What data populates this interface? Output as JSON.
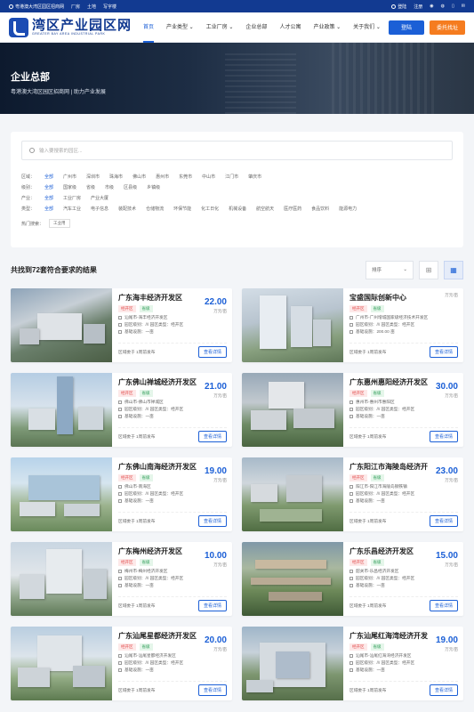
{
  "topbar": {
    "site": "粤港澳大湾区园区招商网",
    "links": [
      "厂房",
      "土地",
      "写字楼"
    ],
    "right": [
      "登陆",
      "注册"
    ]
  },
  "header": {
    "logo_title": "湾区产业园区网",
    "logo_sub": "GREATER BAY AREA INDUSTRIAL PARK",
    "nav": [
      "首页",
      "产业类型 ⌄",
      "工业厂房 ⌄",
      "企业总部",
      "人才公寓",
      "产业政策 ⌄",
      "关于我们 ⌄"
    ],
    "login": "登陆",
    "entrust": "委托找址"
  },
  "banner": {
    "title": "企业总部",
    "subtitle": "粤港澳大湾区园区招商网 | 助力产业发展"
  },
  "filter": {
    "search_placeholder": "输入要搜索的园区...",
    "rows": [
      {
        "label": "区域：",
        "options": [
          "全部",
          "广州市",
          "深圳市",
          "珠海市",
          "佛山市",
          "惠州市",
          "东莞市",
          "中山市",
          "江门市",
          "肇庆市"
        ]
      },
      {
        "label": "级别：",
        "options": [
          "全部",
          "国家级",
          "省级",
          "市级",
          "区县级",
          "乡镇级"
        ]
      },
      {
        "label": "产业：",
        "options": [
          "全部",
          "工业厂房",
          "产业大厦"
        ]
      },
      {
        "label": "类型：",
        "options": [
          "全部",
          "汽车工业",
          "电子信息",
          "装配技术",
          "仓储物流",
          "环保节能",
          "化工日化",
          "机械设备",
          "航空航天",
          "医疗医药",
          "食品饮料",
          "能源电力"
        ]
      }
    ],
    "hot_label": "热门搜索：",
    "hot_tags": [
      "工业用"
    ]
  },
  "results": {
    "title": "共找到72套符合要求的结果",
    "sort": "排序"
  },
  "cards": [
    {
      "name": "广东海丰经济开发区",
      "price": "22.00",
      "unit": "万元/亩",
      "tag1": "经开区",
      "tag2": "省级",
      "loc": "汕尾市-海丰经济开发区",
      "level": "园区级别：/// 园区类型：经开区",
      "facility": "基础设施：一亩",
      "time": "区域委于 1周前发布",
      "btn": "查看详情",
      "img": "a"
    },
    {
      "name": "宝盛国际创新中心",
      "price": "",
      "unit": "万元/亩",
      "tag1": "经开区",
      "tag2": "省级",
      "loc": "广州市-广州增城国家级经济技术开发区",
      "level": "园区级别：/// 园区类型：经开区",
      "facility": "基础设施：200.00 亩",
      "time": "区域委于 1周前发布",
      "btn": "查看详情",
      "img": "b"
    },
    {
      "name": "广东佛山禅城经济开发区",
      "price": "21.00",
      "unit": "万元/亩",
      "tag1": "经开区",
      "tag2": "省级",
      "loc": "佛山市-佛山市禅城区",
      "level": "园区级别：/// 园区类型：经开区",
      "facility": "基础设施：一亩",
      "time": "区域委于 1周前发布",
      "btn": "查看详情",
      "img": "c"
    },
    {
      "name": "广东惠州惠阳经济开发区",
      "price": "30.00",
      "unit": "万元/亩",
      "tag1": "经开区",
      "tag2": "省级",
      "loc": "惠州市-惠州市惠阳区",
      "level": "园区级别：/// 园区类型：经开区",
      "facility": "基础设施：一亩",
      "time": "区域委于 1周前发布",
      "btn": "查看详情",
      "img": "d"
    },
    {
      "name": "广东佛山南海经济开发区",
      "price": "19.00",
      "unit": "万元/亩",
      "tag1": "经开区",
      "tag2": "省级",
      "loc": "佛山市-南海区",
      "level": "园区级别：/// 园区类型：经开区",
      "facility": "基础设施：一亩",
      "time": "区域委于 1周前发布",
      "btn": "查看详情",
      "img": "e"
    },
    {
      "name": "广东阳江市海陵岛经济开",
      "price": "23.00",
      "unit": "万元/亩",
      "tag1": "经开区",
      "tag2": "省级",
      "loc": "阳江市-阳江市海陵岛钢铁镇",
      "level": "园区级别：/// 园区类型：经开区",
      "facility": "基础设施：一亩",
      "time": "区域委于 1周前发布",
      "btn": "查看详情",
      "img": "f"
    },
    {
      "name": "广东梅州经济开发区",
      "price": "10.00",
      "unit": "万元/亩",
      "tag1": "经开区",
      "tag2": "省级",
      "loc": "梅州市-梅州经济开发区",
      "level": "园区级别：/// 园区类型：经开区",
      "facility": "基础设施：一亩",
      "time": "区域委于 1周前发布",
      "btn": "查看详情",
      "img": "g"
    },
    {
      "name": "广东乐昌经济开发区",
      "price": "15.00",
      "unit": "万元/亩",
      "tag1": "经开区",
      "tag2": "省级",
      "loc": "韶关市-乐昌经济开发区",
      "level": "园区级别：/// 园区类型：经开区",
      "facility": "基础设施：一亩",
      "time": "区域委于 1周前发布",
      "btn": "查看详情",
      "img": "h"
    },
    {
      "name": "广东汕尾星都经济开发区",
      "price": "20.00",
      "unit": "万元/亩",
      "tag1": "经开区",
      "tag2": "省级",
      "loc": "汕尾市-汕尾星都经济开发区",
      "level": "园区级别：/// 园区类型：经开区",
      "facility": "基础设施：一亩",
      "time": "区域委于 1周前发布",
      "btn": "查看详情",
      "img": "i"
    },
    {
      "name": "广东汕尾红海湾经济开发",
      "price": "19.00",
      "unit": "万元/亩",
      "tag1": "经开区",
      "tag2": "省级",
      "loc": "汕尾市-汕尾红海湾经济开发区",
      "level": "园区级别：/// 园区类型：经开区",
      "facility": "基础设施：一亩",
      "time": "区域委于 1周前发布",
      "btn": "查看详情",
      "img": "j"
    }
  ],
  "colors": {
    "primary": "#1b5fd6",
    "navy": "#123a91",
    "orange": "#f57c1f"
  }
}
